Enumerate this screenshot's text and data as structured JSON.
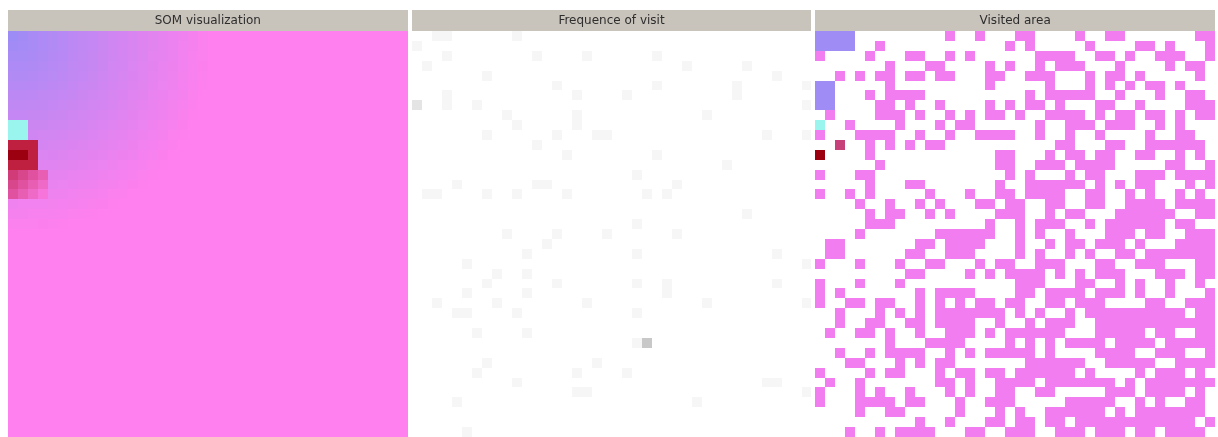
{
  "panels": [
    {
      "title": "SOM visualization",
      "kind": "som"
    },
    {
      "title": "Frequence of visit",
      "kind": "frequency"
    },
    {
      "title": "Visited area",
      "kind": "visited"
    }
  ]
}
